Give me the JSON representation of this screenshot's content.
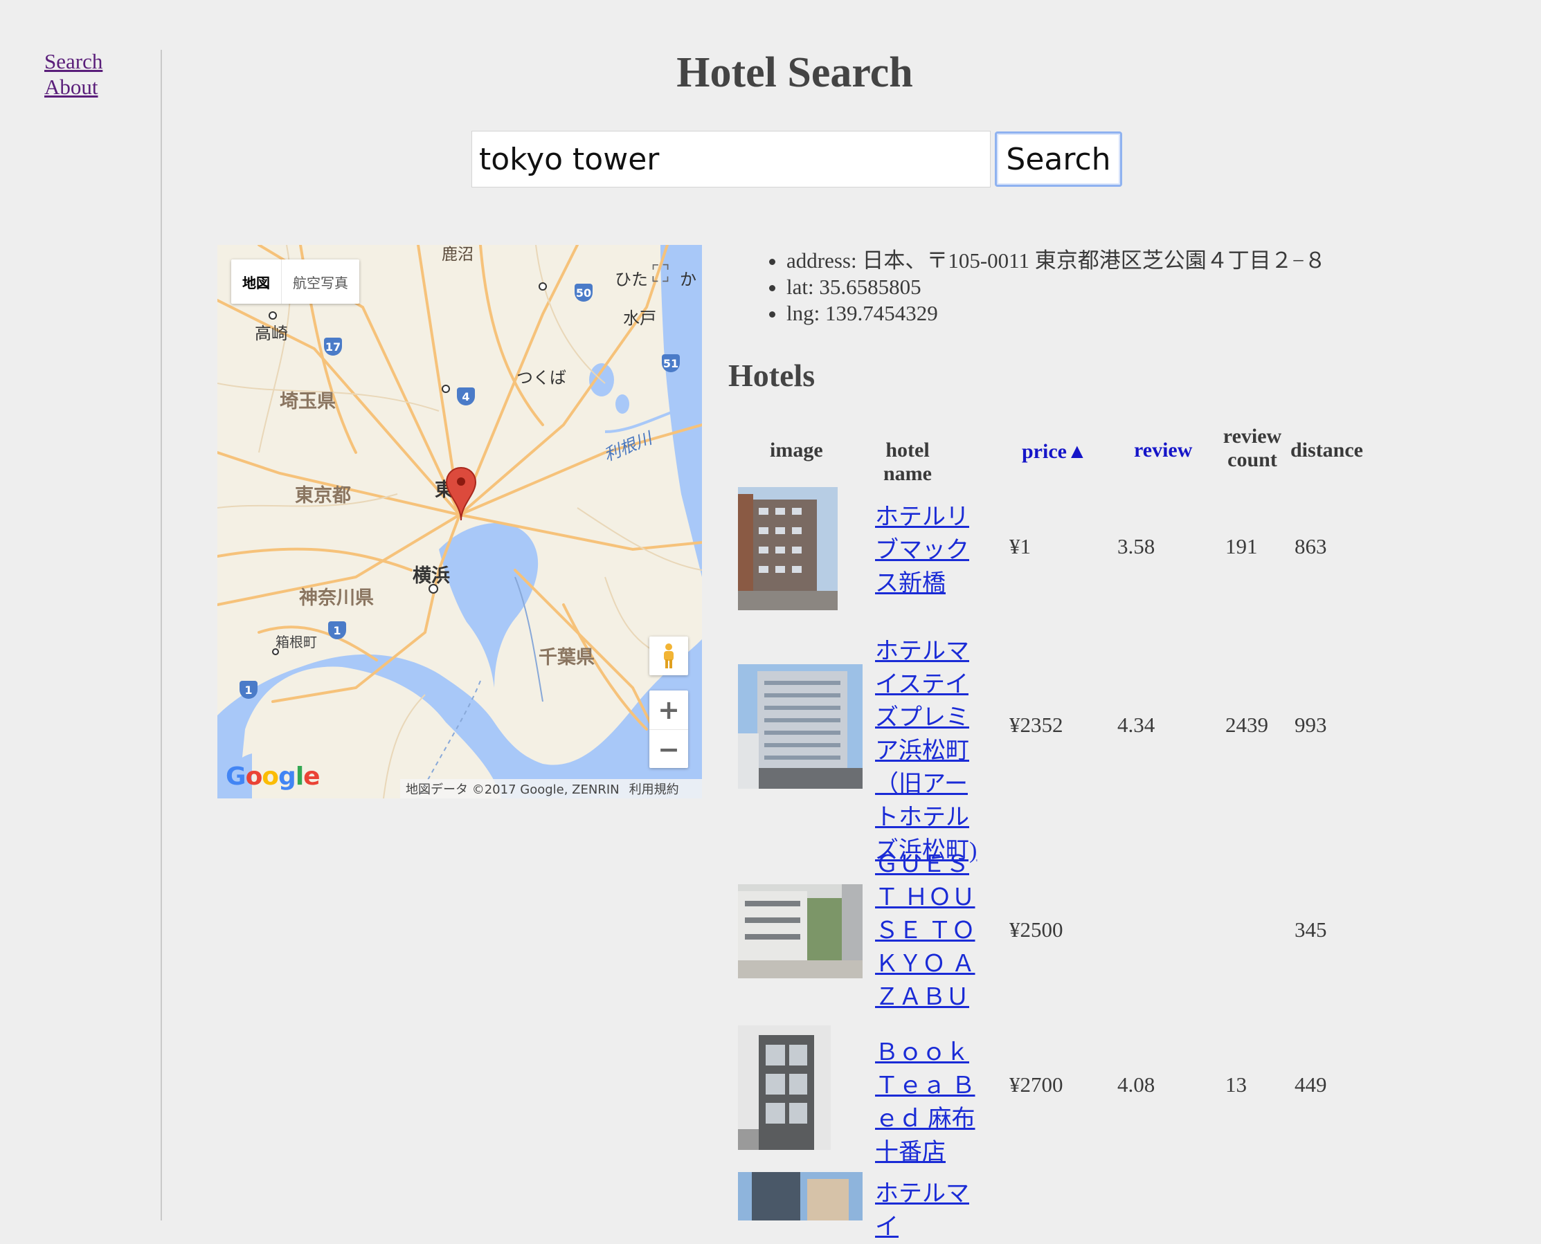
{
  "nav": {
    "search_label": "Search",
    "about_label": "About"
  },
  "title": "Hotel Search",
  "search": {
    "value": "tokyo tower",
    "button_label": "Search"
  },
  "map": {
    "map_type_map": "地図",
    "map_type_satellite": "航空写真",
    "credits": "地図データ ©2017 Google, ZENRIN",
    "terms": "利用規約",
    "zoom_in": "+",
    "zoom_out": "−",
    "labels": {
      "kanuma": "鹿沼",
      "hitachi": "ひた",
      "ka": "か",
      "mito": "水戸",
      "takasaki": "高崎",
      "tsukuba": "つくば",
      "saitama": "埼玉県",
      "tonegawa": "利根川",
      "tokyo_to": "東京都",
      "tokyo": "東京",
      "yokohama": "横浜",
      "kanagawa": "神奈川県",
      "hakone": "箱根町",
      "chiba": "千葉県"
    },
    "routes": {
      "r50": "50",
      "r17": "17",
      "r51": "51",
      "r4": "4",
      "r1a": "1",
      "r1b": "1"
    },
    "logo": {
      "G": "G",
      "o1": "o",
      "o2": "o",
      "g": "g",
      "l": "l",
      "e": "e"
    },
    "colors": {
      "water": "#a8c8f8",
      "land": "#f4f0e4",
      "road": "#f6c27a",
      "pin": "#dc4a3c"
    }
  },
  "location": {
    "address": "address: 日本、〒105-0011 東京都港区芝公園４丁目２−８",
    "lat": "lat: 35.6585805",
    "lng": "lng: 139.7454329"
  },
  "hotels_heading": "Hotels",
  "table": {
    "headers": {
      "image": "image",
      "name": "hotel name",
      "price": "price▲",
      "review": "review",
      "review_count_1": "review",
      "review_count_2": "count",
      "distance": "distance"
    },
    "rows": [
      {
        "name": "ホテルリブマックス新橋",
        "price": "¥1",
        "review": "3.58",
        "review_count": "191",
        "distance": "863"
      },
      {
        "name": "ホテルマイステイズプレミア浜松町（旧アートホテルズ浜松町)",
        "price": "¥2352",
        "review": "4.34",
        "review_count": "2439",
        "distance": "993"
      },
      {
        "name": "ＧＵＥＳＴ ＨＯＵＳＥ ＴＯＫＹＯ ＡＺＡＢＵ",
        "price": "¥2500",
        "review": "",
        "review_count": "",
        "distance": "345"
      },
      {
        "name": "Ｂｏｏｋ Ｔｅａ Ｂｅｄ 麻布十番店",
        "price": "¥2700",
        "review": "4.08",
        "review_count": "13",
        "distance": "449"
      },
      {
        "name": "ホテルマイ",
        "price": "",
        "review": "",
        "review_count": "",
        "distance": ""
      }
    ]
  },
  "colors": {
    "link_visited": "#5a1e7a",
    "link": "#1a2bd6",
    "sort_header": "#1515c8",
    "background": "#eeeeee"
  }
}
